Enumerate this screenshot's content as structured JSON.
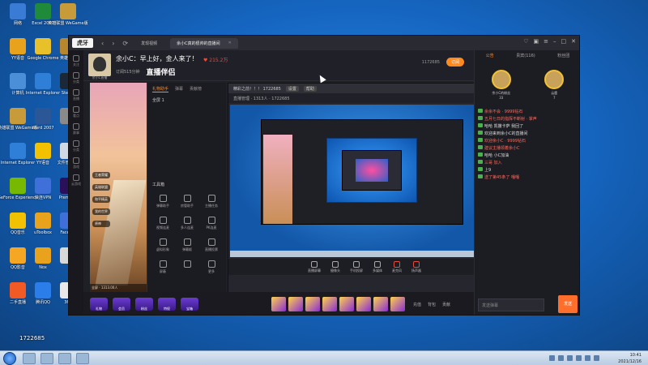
{
  "desktop_icons": [
    {
      "label": "网络",
      "color": "#3a7bd5"
    },
    {
      "label": "Excel 2007",
      "color": "#1f8b3a"
    },
    {
      "label": "英雄联盟\nWeGame版",
      "color": "#c79a3a"
    },
    {
      "label": "YY语音",
      "color": "#e8a21b"
    },
    {
      "label": "Google\nChrome",
      "color": "#e8c12a"
    },
    {
      "label": "英雄联盟",
      "color": "#b8862d"
    },
    {
      "label": "计算机",
      "color": "#4a8fd8"
    },
    {
      "label": "Internet\nExplorer",
      "color": "#2f7fd8"
    },
    {
      "label": "Steam",
      "color": "#1b2838"
    },
    {
      "label": "英雄联盟\nWeGame版",
      "color": "#c79a3a"
    },
    {
      "label": "Word 2007",
      "color": "#2b5797"
    },
    {
      "label": "",
      "color": "#8a8a8a"
    },
    {
      "label": "Internet\nExplorer",
      "color": "#2f7fd8"
    },
    {
      "label": "YY语音",
      "color": "#f2c200"
    },
    {
      "label": "文件管\n理器",
      "color": "#cfd8e3"
    },
    {
      "label": "GeForce\nExperience",
      "color": "#76b900"
    },
    {
      "label": "快连VPN",
      "color": "#3f6fd8"
    },
    {
      "label": "Premiere",
      "color": "#2a0f5a"
    },
    {
      "label": "QQ音乐",
      "color": "#f2c200"
    },
    {
      "label": "uToolbox",
      "color": "#e8a21b"
    },
    {
      "label": "FaceRig",
      "color": "#3f6fd8"
    },
    {
      "label": "QQ影音",
      "color": "#f5a623"
    },
    {
      "label": "Nox",
      "color": "#e8a21b"
    },
    {
      "label": "",
      "color": "#d8d8d8"
    },
    {
      "label": "二手直播",
      "color": "#f15a24"
    },
    {
      "label": "腾讯QQ",
      "color": "#2b7de9"
    },
    {
      "label": "360",
      "color": "#e8e8e8"
    }
  ],
  "app": {
    "logo": "虎牙",
    "tab_label": "余小C真的很帅的直播间",
    "tab_home": "发现视频",
    "streamer": {
      "avatar_label": "余小C直播",
      "room_title": "余小C：早上好，金人来了！",
      "fans": "215.2万",
      "subscribe": "订阅515分钟",
      "brand": "直播伴侣",
      "room_id_label": "1172685",
      "follow": "订阅"
    },
    "left_nav": [
      "关注",
      "分类",
      "直播",
      "看点",
      "赛事",
      "分类",
      "游戏",
      "云游戏"
    ],
    "video_chips": [
      "王者荣耀",
      "英雄联盟",
      "和平精英",
      "我的世界",
      "原神"
    ],
    "video_bottom": "全屏 · 1313.00人",
    "assist_tabs": [
      "礼物助手",
      "弹幕",
      "贡献榜"
    ],
    "assist_rows": [
      "全屏 1"
    ],
    "tool_title": "工具箱",
    "tools": [
      "弹幕助手",
      "房管助手",
      "主播任务",
      "视频连麦",
      "多人连麦",
      "PK连麦",
      "虚拟形象",
      "弹幕姬",
      "直播投票",
      "屏蔽",
      "",
      "更多"
    ],
    "inner": {
      "title": "精彩之前！！！ 1722685",
      "tags": [
        "设置",
        "帮助"
      ],
      "toolbar": "直播管理 · 1313人 · 1722685",
      "bottom_tools": [
        "直播屏幕",
        "摄像头",
        "手机投屏",
        "多媒体",
        "麦克风",
        "扬声器"
      ]
    },
    "gifts_left": [
      "礼物",
      "会员",
      "粉丝",
      "特权",
      "宝箱"
    ],
    "gift_meta": [
      "充值",
      "背包",
      "贡献"
    ],
    "right_panel": {
      "tabs": [
        "公告",
        "贵宾(116)",
        "粉丝团"
      ],
      "vips": [
        {
          "name": "余小C的粉丝",
          "level": "33"
        },
        {
          "name": "云鹿",
          "level": "7"
        }
      ],
      "chat": [
        {
          "text": "余余不会 · 9999钻石",
          "type": "red"
        },
        {
          "text": "五月七日的指挥不断射 · 掌声",
          "type": "red"
        },
        {
          "text": "哈哈 凯撒卡萨 我回了",
          "type": "norm"
        },
        {
          "text": "欢迎来到余小C的直播间",
          "type": "norm"
        },
        {
          "text": "欢迎余小C · 9999钻石",
          "type": "red"
        },
        {
          "text": "建议主播领着余小C",
          "type": "red"
        },
        {
          "text": "哈哈 小C加油",
          "type": "norm"
        },
        {
          "text": "三哥 加入",
          "type": "red"
        },
        {
          "text": "上9",
          "type": "norm"
        },
        {
          "text": "送了第45条了 嘎嘎",
          "type": "red"
        }
      ],
      "input_placeholder": "发送弹幕",
      "send": "发送"
    }
  },
  "overlay_text": "1722685",
  "clock": {
    "time": "10:41",
    "date": "2021/12/16"
  }
}
